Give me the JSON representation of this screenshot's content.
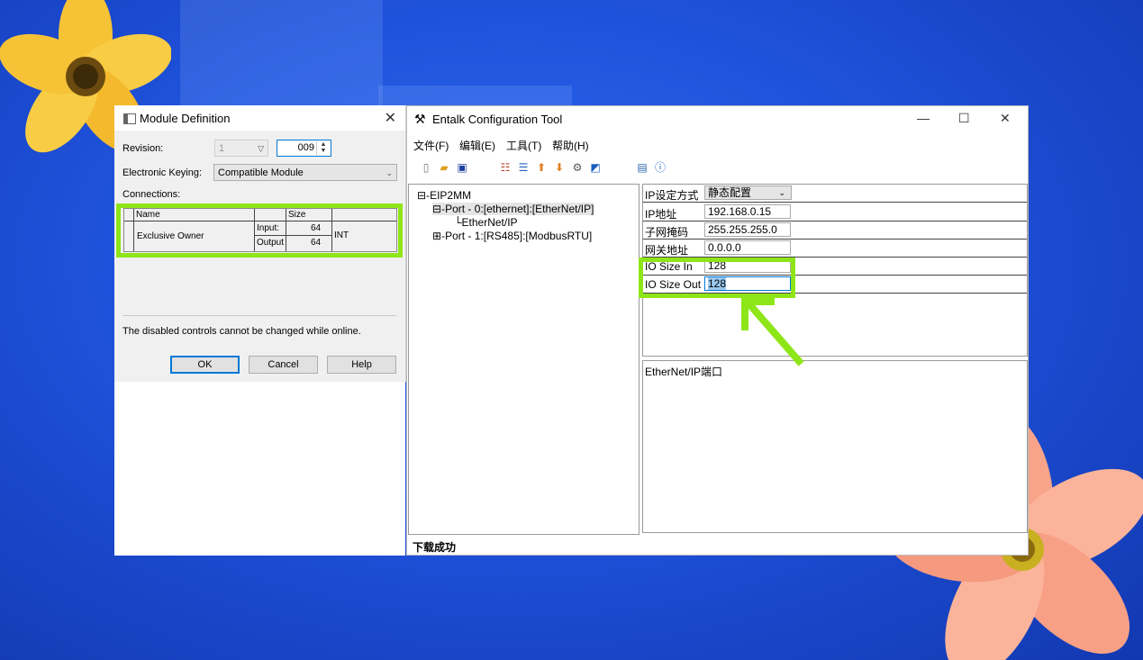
{
  "module_definition": {
    "title": "Module Definition",
    "revision_label": "Revision:",
    "revision_major": "1",
    "revision_minor": "009",
    "keying_label": "Electronic Keying:",
    "keying_value": "Compatible Module",
    "connections_label": "Connections:",
    "table": {
      "col_name": "Name",
      "col_size": "Size",
      "row_name": "Exclusive Owner",
      "input_label": "Input:",
      "input_size": "64",
      "output_label": "Output",
      "output_size": "64",
      "type": "INT"
    },
    "note": "The disabled controls cannot be changed while online.",
    "ok": "OK",
    "cancel": "Cancel",
    "help": "Help"
  },
  "entalk": {
    "title": "Entalk Configuration Tool",
    "menu": [
      "文件(F)",
      "编辑(E)",
      "工具(T)",
      "帮助(H)"
    ],
    "tree": {
      "root": "EIP2MM",
      "port0": "Port - 0:[ethernet]:[EtherNet/IP]",
      "port0_child": "EtherNet/IP",
      "port1": "Port - 1:[RS485]:[ModbusRTU]"
    },
    "props": [
      {
        "key": "IP设定方式",
        "value": "静态配置"
      },
      {
        "key": "IP地址",
        "value": "192.168.0.15"
      },
      {
        "key": "子网掩码",
        "value": "255.255.255.0"
      },
      {
        "key": "网关地址",
        "value": "0.0.0.0"
      },
      {
        "key": "IO Size In",
        "value": "128"
      },
      {
        "key": "IO Size Out",
        "value": "128"
      }
    ],
    "description": "EtherNet/IP端口",
    "status": "下载成功"
  },
  "colors": {
    "highlight": "#8ee619",
    "background": "#1f52dc"
  }
}
